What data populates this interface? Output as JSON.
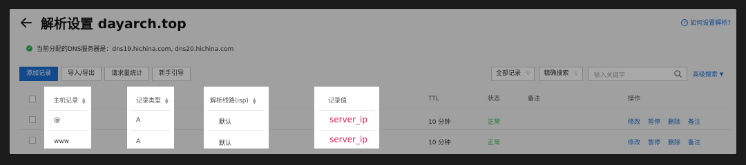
{
  "header": {
    "title": "解析设置 dayarch.top",
    "help_label": "如何设置解析?"
  },
  "dns_notice": {
    "text": "当前分配的DNS服务器是：dns19.hichina.com, dns20.hichina.com"
  },
  "toolbar": {
    "buttons": [
      "添加记录",
      "导入/导出",
      "请求量统计",
      "新手引导"
    ]
  },
  "filters": {
    "record_filter": "全部记录",
    "search_mode": "精确搜索",
    "search_placeholder": "输入关键字",
    "advanced_search": "高级搜索"
  },
  "table": {
    "columns": {
      "host": "主机记录",
      "type": "记录类型",
      "line": "解析线路(isp)",
      "value": "记录值",
      "ttl": "TTL",
      "status": "状态",
      "remark": "备注",
      "actions": "操作"
    },
    "rows": [
      {
        "host": "@",
        "type": "A",
        "line": "默认",
        "value": "server_ip",
        "ttl": "10 分钟",
        "status": "正常"
      },
      {
        "host": "www",
        "type": "A",
        "line": "默认",
        "value": "server_ip",
        "ttl": "10 分钟",
        "status": "正常"
      }
    ],
    "row_actions": [
      "修改",
      "暂停",
      "删除",
      "备注"
    ]
  },
  "colors": {
    "accent": "#1a6fd4",
    "status_ok": "#2fb150",
    "value_highlight": "#e0245e"
  }
}
